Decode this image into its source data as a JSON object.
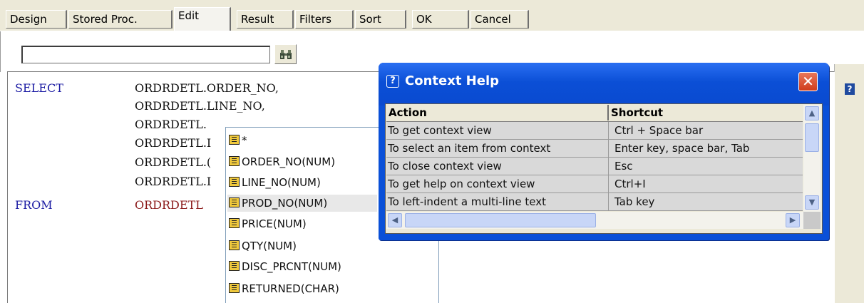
{
  "tabs": [
    {
      "label": "Design"
    },
    {
      "label": "Stored Proc."
    },
    {
      "label": "Edit"
    },
    {
      "label": "Result"
    },
    {
      "label": "Filters"
    },
    {
      "label": "Sort"
    },
    {
      "label": "OK"
    },
    {
      "label": "Cancel"
    }
  ],
  "search": {
    "value": "",
    "placeholder": "",
    "find_icon": "binoculars-icon"
  },
  "editor": {
    "lines": [
      {
        "keyword": "SELECT",
        "text": "ORDRDETL.ORDER_NO,"
      },
      {
        "keyword": "",
        "text": "ORDRDETL.LINE_NO,"
      },
      {
        "keyword": "",
        "text": "ORDRDETL."
      },
      {
        "keyword": "",
        "text": "ORDRDETL.I"
      },
      {
        "keyword": "",
        "text": "ORDRDETL.("
      },
      {
        "keyword": "",
        "text": "ORDRDETL.I"
      },
      {
        "keyword": "FROM",
        "text": "ORDRDETL"
      }
    ]
  },
  "autocomplete": {
    "items": [
      {
        "label": "*"
      },
      {
        "label": "ORDER_NO(NUM)"
      },
      {
        "label": "LINE_NO(NUM)"
      },
      {
        "label": "PROD_NO(NUM)",
        "selected": true
      },
      {
        "label": "PRICE(NUM)"
      },
      {
        "label": "QTY(NUM)"
      },
      {
        "label": "DISC_PRCNT(NUM)"
      },
      {
        "label": "RETURNED(CHAR)"
      }
    ],
    "icon": "column-icon"
  },
  "context_help": {
    "title": "Context Help",
    "title_icon": "?",
    "close_label": "✕",
    "columns": [
      "Action",
      "Shortcut"
    ],
    "rows": [
      [
        "To get context view",
        "Ctrl + Space bar"
      ],
      [
        "To select an item from context",
        "Enter key, space bar, Tab"
      ],
      [
        "To close context view",
        "Esc"
      ],
      [
        "To get help on context view",
        "Ctrl+I"
      ],
      [
        "To left-indent a multi-line text",
        "Tab key"
      ]
    ]
  },
  "help_mini_label": "?",
  "colors": {
    "keyword": "#1b1ba3",
    "table_name": "#8b1a1a",
    "title_bar": "#0a50d8",
    "close_button": "#d5482a"
  }
}
